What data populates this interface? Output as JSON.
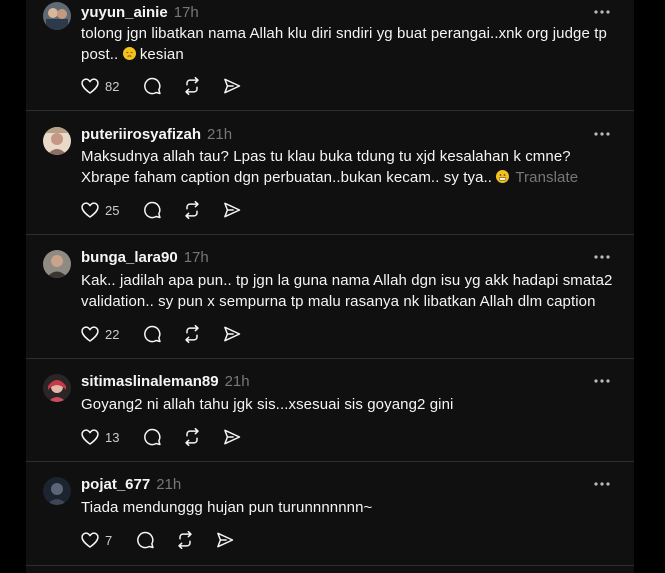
{
  "colors": {
    "background": "#101010",
    "text": "#f3f5f7",
    "muted": "#777777",
    "divider": "#2d2d2d"
  },
  "icons": {
    "like": "heart-icon",
    "reply": "comment-icon",
    "repost": "repost-icon",
    "share": "send-icon",
    "more": "more-icon"
  },
  "posts": [
    {
      "username": "yuyun_ainie",
      "time": "17h",
      "text": "tolong jgn libatkan nama Allah klu diri sndiri yg buat perangai..xnk org judge tp post.. ",
      "text_after": " kesian",
      "emoji": "pensive-face",
      "likes": "82"
    },
    {
      "username": "puteriirosyafizah",
      "time": "21h",
      "text": "Maksudnya allah tau? Lpas tu klau buka tdung tu xjd kesalahan k cmne? Xbrape faham caption dgn perbuatan..bukan kecam.. sy tya.. ",
      "emoji": "grimacing-face",
      "translate": "Translate",
      "likes": "25"
    },
    {
      "username": "bunga_lara90",
      "time": "17h",
      "text": "Kak.. jadilah apa pun.. tp jgn la guna nama Allah dgn isu yg akk hadapi smata2 validation.. sy pun x sempurna tp malu rasanya nk libatkan Allah dlm caption",
      "likes": "22"
    },
    {
      "username": "sitimaslinaleman89",
      "time": "21h",
      "text": "Goyang2 ni allah tahu jgk sis...xsesuai sis goyang2 gini",
      "likes": "13"
    },
    {
      "username": "pojat_677",
      "time": "21h",
      "text": "Tiada mendunggg hujan pun turunnnnnnn~",
      "likes": "7"
    }
  ]
}
